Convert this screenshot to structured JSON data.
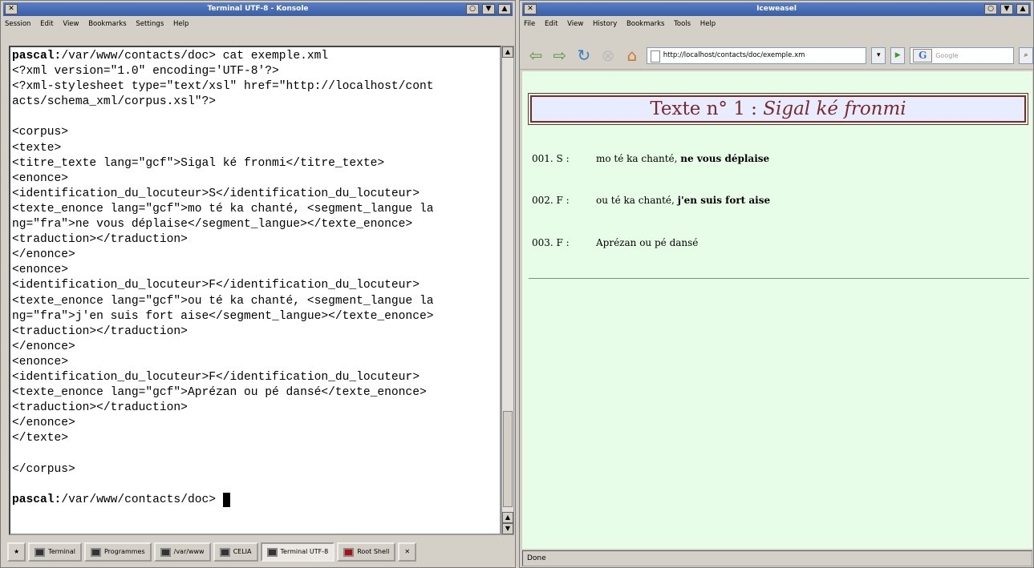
{
  "konsole": {
    "title": "Terminal UTF-8 - Konsole",
    "menu": [
      "Session",
      "Edit",
      "View",
      "Bookmarks",
      "Settings",
      "Help"
    ],
    "prompt_user": "pascal:",
    "prompt_path": "/var/www/contacts/doc>",
    "command": " cat exemple.xml",
    "lines": [
      "<?xml version=\"1.0\" encoding='UTF-8'?>",
      "<?xml-stylesheet type=\"text/xsl\" href=\"http://localhost/cont",
      "acts/schema_xml/corpus.xsl\"?>",
      "",
      "<corpus>",
      "<texte>",
      "<titre_texte lang=\"gcf\">Sigal ké fronmi</titre_texte>",
      "<enonce>",
      "<identification_du_locuteur>S</identification_du_locuteur>",
      "<texte_enonce lang=\"gcf\">mo té ka chanté, <segment_langue la",
      "ng=\"fra\">ne vous déplaise</segment_langue></texte_enonce>",
      "<traduction></traduction>",
      "</enonce>",
      "<enonce>",
      "<identification_du_locuteur>F</identification_du_locuteur>",
      "<texte_enonce lang=\"gcf\">ou té ka chanté, <segment_langue la",
      "ng=\"fra\">j'en suis fort aise</segment_langue></texte_enonce>",
      "<traduction></traduction>",
      "</enonce>",
      "<enonce>",
      "<identification_du_locuteur>F</identification_du_locuteur>",
      "<texte_enonce lang=\"gcf\">Aprézan ou pé dansé</texte_enonce>",
      "<traduction></traduction>",
      "</enonce>",
      "</texte>",
      "",
      "</corpus>",
      ""
    ],
    "final_prompt_path": "/var/www/contacts/doc> "
  },
  "taskbar": [
    "Terminal",
    "Programmes",
    "/var/www",
    "CELIA",
    "Terminal UTF-8",
    "Root Shell"
  ],
  "iceweasel": {
    "title": "Iceweasel",
    "menu": [
      "File",
      "Edit",
      "View",
      "History",
      "Bookmarks",
      "Tools",
      "Help"
    ],
    "url": "http://localhost/contacts/doc/exemple.xm",
    "search_placeholder": "Google",
    "heading_prefix": "Texte n° 1  : ",
    "heading_title": "Sigal ké fronmi",
    "rows": [
      {
        "id": "001. S :",
        "text": "mo té ka chanté, ",
        "bold": "ne vous déplaise"
      },
      {
        "id": "002. F :",
        "text": "ou té ka chanté, ",
        "bold": "j'en suis fort aise"
      },
      {
        "id": "003. F :",
        "text": "Aprézan ou pé dansé",
        "bold": ""
      }
    ],
    "status": "Done"
  }
}
